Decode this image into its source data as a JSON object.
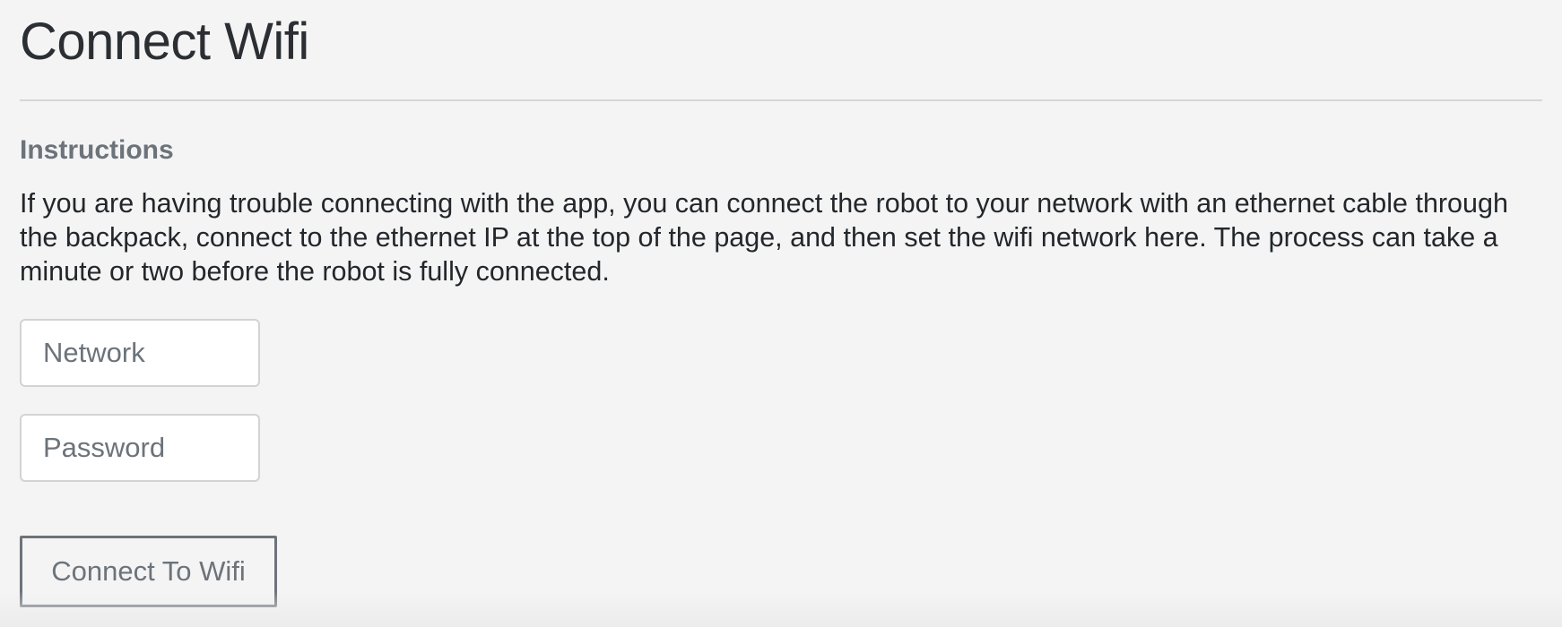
{
  "page": {
    "title": "Connect Wifi"
  },
  "instructions": {
    "heading": "Instructions",
    "body": "If you are having trouble connecting with the app, you can connect the robot to your network with an ethernet cable through the backpack, connect to the ethernet IP at the top of the page, and then set the wifi network here. The process can take a minute or two before the robot is fully connected."
  },
  "form": {
    "network": {
      "placeholder": "Network",
      "value": ""
    },
    "password": {
      "placeholder": "Password",
      "value": ""
    },
    "submit_label": "Connect To Wifi"
  },
  "colors": {
    "background": "#f4f4f4",
    "title_text": "#2b2f33",
    "muted_text": "#6c737a",
    "input_border": "#d3d3d3",
    "divider": "#d6d6d6"
  }
}
